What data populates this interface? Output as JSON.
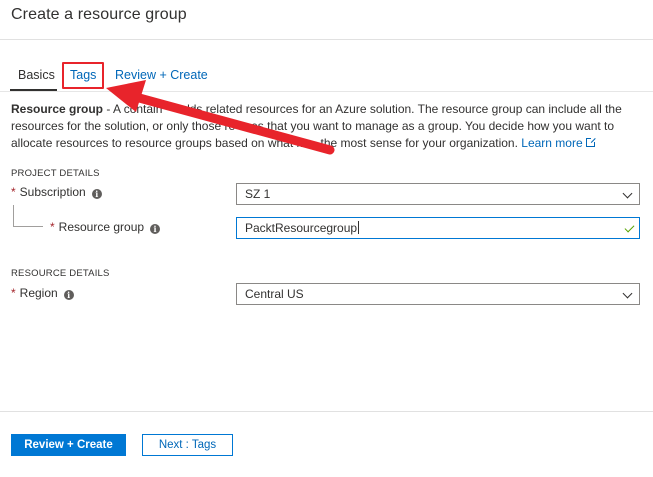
{
  "header": {
    "title": "Create a resource group"
  },
  "tabs": [
    {
      "label": "Basics",
      "selected": true
    },
    {
      "label": "Tags",
      "selected": false,
      "highlighted": true
    },
    {
      "label": "Review + Create",
      "selected": false
    }
  ],
  "description": {
    "bold": "Resource group",
    "text_1": " - A contain",
    "text_2": "olds related resources for an Azure solution. The resource group can include all the resources for the solution, or only those re",
    "text_3": "es that you want to manage as a group. You decide how you want to allocate resources to resource groups based on what m",
    "text_4": "the most sense for your organization. ",
    "link": "Learn more"
  },
  "project_details": {
    "heading": "PROJECT DETAILS",
    "subscription": {
      "label": "Subscription",
      "required": "*",
      "value": "SZ 1"
    },
    "resource_group": {
      "label": "Resource group",
      "required": "*",
      "value": "PacktResourcegroup"
    }
  },
  "resource_details": {
    "heading": "RESOURCE DETAILS",
    "region": {
      "label": "Region",
      "required": "*",
      "value": "Central US"
    }
  },
  "footer": {
    "primary_label": "Review + Create",
    "secondary_label": "Next : Tags"
  },
  "colors": {
    "accent": "#0078d4",
    "link": "#0067b8",
    "highlight": "#e8242b",
    "required": "#a4262c",
    "valid": "#57a300"
  },
  "icons": [
    "info-icon",
    "external-link-icon",
    "chevron-down-icon",
    "checkmark-icon",
    "annotation-arrow"
  ]
}
